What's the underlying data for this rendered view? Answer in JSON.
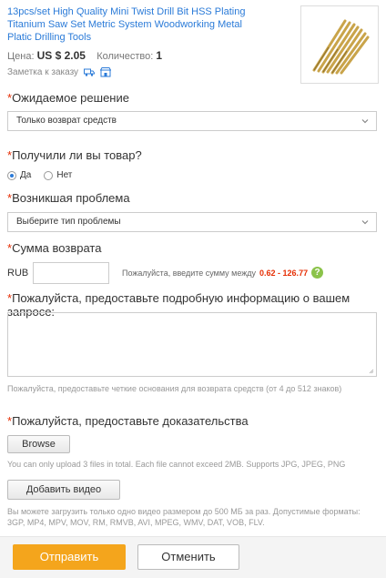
{
  "product": {
    "title": "13pcs/set High Quality Mini Twist Drill Bit HSS Plating Titanium Saw Set Metric System Woodworking Metal Platic Drilling Tools",
    "price_label": "Цена:",
    "price": "US $ 2.05",
    "qty_label": "Количество:",
    "qty": "1",
    "note_label": "Заметка к заказу"
  },
  "solution": {
    "label": "Ожидаемое решение",
    "selected": "Только возврат средств"
  },
  "received": {
    "label": "Получили ли вы товар?",
    "yes": "Да",
    "no": "Нет"
  },
  "problem": {
    "label": "Возникшая проблема",
    "placeholder": "Выберите тип проблемы"
  },
  "refund": {
    "label": "Сумма возврата",
    "currency": "RUB",
    "hint": "Пожалуйста, введите сумму между",
    "range": "0.62 - 126.77"
  },
  "details": {
    "label": "Пожалуйста, предоставьте подробную информацию о вашем запросе:",
    "hint": "Пожалуйста, предоставьте четкие основания для возврата средств (от 4 до 512 знаков)"
  },
  "evidence": {
    "label": "Пожалуйста, предоставьте доказательства",
    "browse": "Browse",
    "upload_hint": "You can only upload 3 files in total. Each file cannot exceed 2MB. Supports JPG, JPEG, PNG",
    "video_button": "Добавить видео",
    "video_hint": "Вы можете загрузить только одно видео размером до 500 МБ за раз. Допустимые форматы: 3GP, MP4, MPV, MOV, RM, RMVB, AVI, MPEG, WMV, DAT, VOB, FLV."
  },
  "actions": {
    "submit": "Отправить",
    "cancel": "Отменить"
  },
  "required_mark": "*",
  "colors": {
    "link": "#2b7bd8",
    "required": "#e62e04",
    "submit": "#f4a51c",
    "help": "#8bc34a"
  }
}
